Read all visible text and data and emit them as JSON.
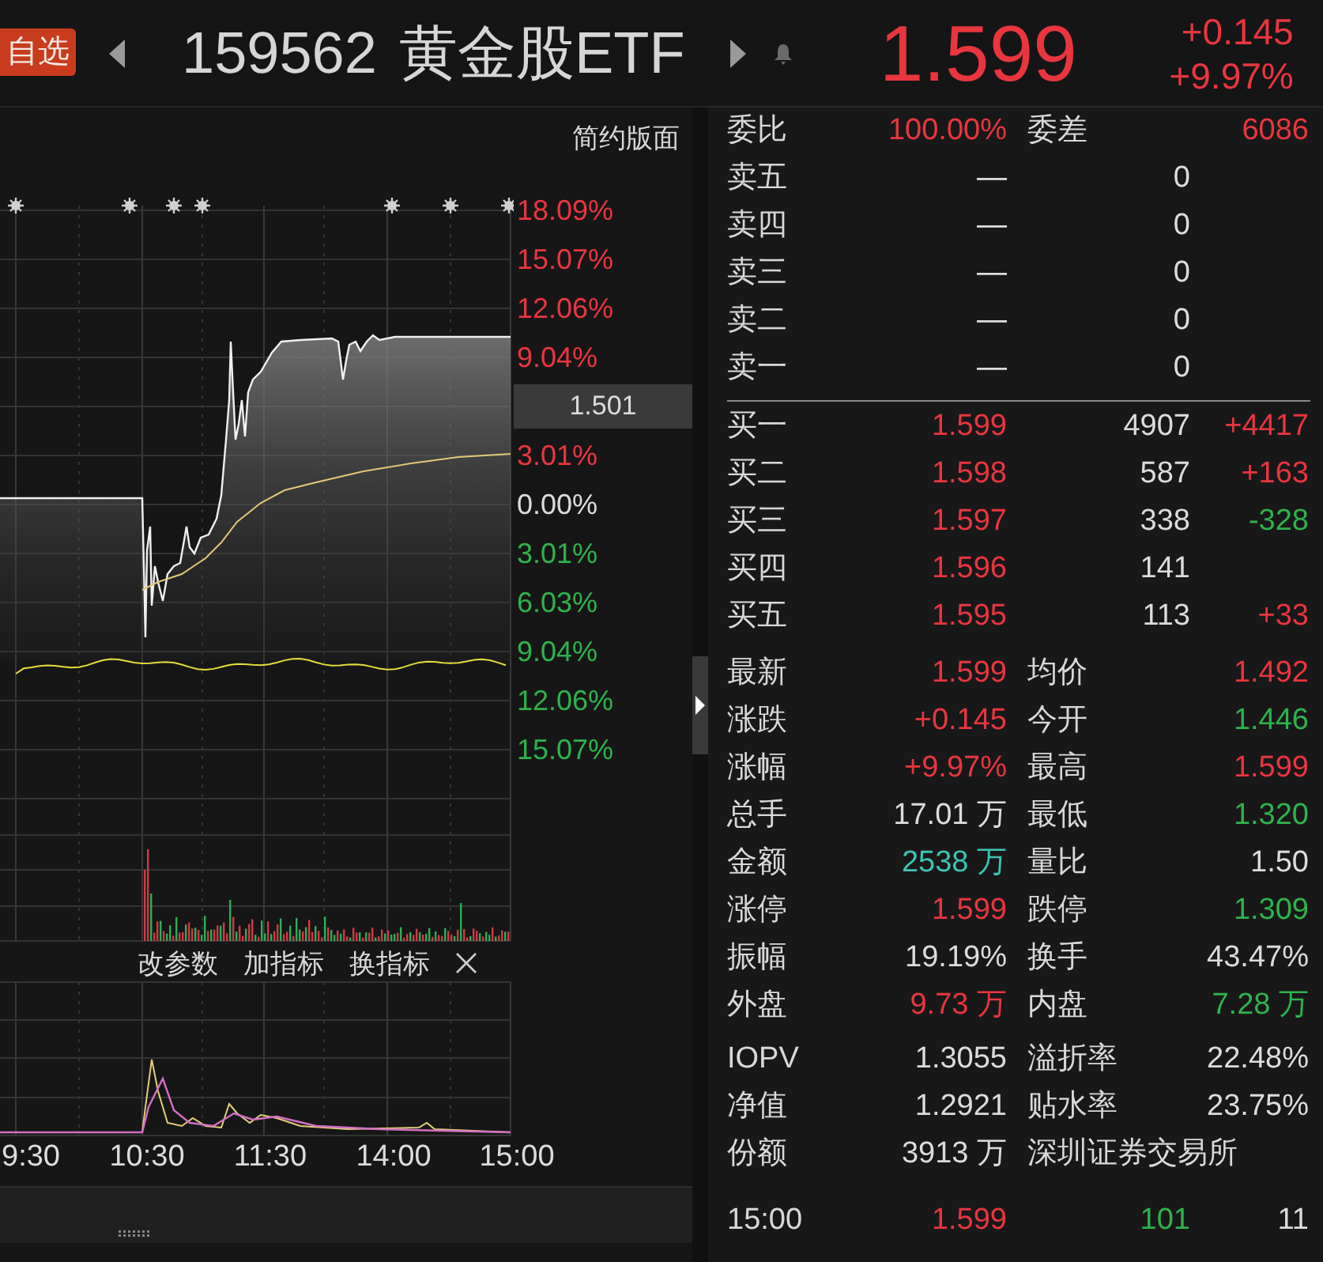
{
  "header": {
    "watch_button": "自选",
    "code": "159562",
    "name": "黄金股ETF",
    "price": "1.599",
    "change": "+0.145",
    "change_pct": "+9.97%",
    "color": "#e8363f"
  },
  "chart": {
    "layout_link": "简约版面",
    "axis_labels": [
      {
        "text": "18.09%",
        "kind": "label",
        "color": "#e8363f"
      },
      {
        "text": "15.07%",
        "kind": "label",
        "color": "#e8363f"
      },
      {
        "text": "12.06%",
        "kind": "label",
        "color": "#e8363f"
      },
      {
        "text": "9.04%",
        "kind": "label",
        "color": "#e8363f"
      },
      {
        "text": "1.501",
        "kind": "cursor"
      },
      {
        "text": "3.01%",
        "kind": "label",
        "color": "#e8363f"
      },
      {
        "text": "0.00%",
        "kind": "label",
        "color": "#dcdcdc"
      },
      {
        "text": "3.01%",
        "kind": "label",
        "color": "#2fb24c"
      },
      {
        "text": "6.03%",
        "kind": "label",
        "color": "#2fb24c"
      },
      {
        "text": "9.04%",
        "kind": "label",
        "color": "#2fb24c"
      },
      {
        "text": "12.06%",
        "kind": "label",
        "color": "#2fb24c"
      },
      {
        "text": "15.07%",
        "kind": "label",
        "color": "#2fb24c"
      }
    ],
    "tools": [
      "改参数",
      "加指标",
      "换指标"
    ],
    "time_labels": [
      "9:30",
      "10:30",
      "11:30",
      "14:00",
      "15:00"
    ]
  },
  "order_book": {
    "summary": [
      {
        "label": "委比",
        "value": "100.00%",
        "color": "#e8363f"
      },
      {
        "label": "委差",
        "value": "6086",
        "color": "#e8363f"
      }
    ],
    "asks": [
      {
        "label": "卖五",
        "price": "—",
        "volume": "0"
      },
      {
        "label": "卖四",
        "price": "—",
        "volume": "0"
      },
      {
        "label": "卖三",
        "price": "—",
        "volume": "0"
      },
      {
        "label": "卖二",
        "price": "—",
        "volume": "0"
      },
      {
        "label": "卖一",
        "price": "—",
        "volume": "0"
      }
    ],
    "bids": [
      {
        "label": "买一",
        "price": "1.599",
        "volume": "4907",
        "change": {
          "text": "+4417",
          "color": "#e8363f"
        }
      },
      {
        "label": "买二",
        "price": "1.598",
        "volume": "587",
        "change": {
          "text": "+163",
          "color": "#e8363f"
        }
      },
      {
        "label": "买三",
        "price": "1.597",
        "volume": "338",
        "change": {
          "text": "-328",
          "color": "#2fb24c"
        }
      },
      {
        "label": "买四",
        "price": "1.596",
        "volume": "141"
      },
      {
        "label": "买五",
        "price": "1.595",
        "volume": "113",
        "change": {
          "text": "+33",
          "color": "#e8363f"
        }
      }
    ]
  },
  "stats": [
    {
      "label": "最新",
      "value": "1.599",
      "color": "#e8363f"
    },
    {
      "label": "均价",
      "value": "1.492",
      "color": "#e8363f"
    },
    {
      "label": "涨跌",
      "value": "+0.145",
      "color": "#e8363f"
    },
    {
      "label": "今开",
      "value": "1.446",
      "color": "#2fb24c"
    },
    {
      "label": "涨幅",
      "value": "+9.97%",
      "color": "#e8363f"
    },
    {
      "label": "最高",
      "value": "1.599",
      "color": "#e8363f"
    },
    {
      "label": "总手",
      "value": "17.01 万",
      "color": "#dcdcdc"
    },
    {
      "label": "最低",
      "value": "1.320",
      "color": "#2fb24c"
    },
    {
      "label": "金额",
      "value": "2538 万",
      "color": "#3cc4b4"
    },
    {
      "label": "量比",
      "value": "1.50",
      "color": "#dcdcdc"
    },
    {
      "label": "涨停",
      "value": "1.599",
      "color": "#e8363f"
    },
    {
      "label": "跌停",
      "value": "1.309",
      "color": "#2fb24c"
    },
    {
      "label": "振幅",
      "value": "19.19%",
      "color": "#dcdcdc"
    },
    {
      "label": "换手",
      "value": "43.47%",
      "color": "#dcdcdc"
    },
    {
      "label": "外盘",
      "value": "9.73 万",
      "color": "#e8363f"
    },
    {
      "label": "内盘",
      "value": "7.28 万",
      "color": "#2fb24c"
    }
  ],
  "fund_stats": [
    {
      "label": "IOPV",
      "value": "1.3055"
    },
    {
      "label": "溢折率",
      "value": "22.48%"
    },
    {
      "label": "净值",
      "value": "1.2921"
    },
    {
      "label": "贴水率",
      "value": "23.75%"
    },
    {
      "label": "份额",
      "value": "3913 万"
    }
  ],
  "exchange": "深圳证券交易所",
  "last_trade": {
    "time": "15:00",
    "price": {
      "text": "1.599",
      "color": "#e8363f"
    },
    "volume": {
      "text": "101",
      "color": "#2fb24c"
    },
    "count": "11"
  }
}
